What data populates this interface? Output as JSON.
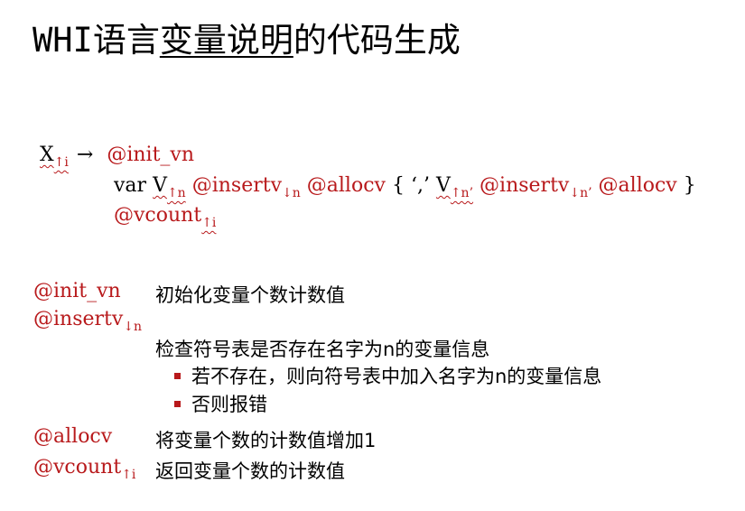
{
  "title": {
    "part1": "WHI语言",
    "part2": "变量说明",
    "part3": "的代码生成"
  },
  "rule": {
    "lhs": "X",
    "lhs_sub": "↑i",
    "arrow": "→",
    "action_init": "@init_vn",
    "kw_var": "var",
    "v": "V",
    "v_sub": "↑n",
    "action_insert": "@insertv",
    "insert_sub": "↓n",
    "action_alloc": "@allocv",
    "brace_open": "{",
    "comma": "‘,’",
    "v2": "V",
    "v2_sub": "↑n’",
    "action_insert2": "@insertv",
    "insert2_sub": "↓n’",
    "action_alloc2": "@allocv",
    "brace_close": "}",
    "action_vcount": "@vcount",
    "vcount_sub": "↑i"
  },
  "descriptions": [
    {
      "name": "@init_vn",
      "sub": "",
      "text": "初始化变量个数计数值"
    },
    {
      "name": "@insertv",
      "sub": "↓n",
      "text": "检查符号表是否存在名字为n的变量信息"
    },
    {
      "name": "@allocv",
      "sub": "",
      "text": "将变量个数的计数值增加1"
    },
    {
      "name": "@vcount",
      "sub": "↑i",
      "text": "返回变量个数的计数值"
    }
  ],
  "bullets": [
    "若不存在，则向符号表中加入名字为n的变量信息",
    "否则报错"
  ],
  "colors": {
    "accent_red": "#b8191b",
    "text": "#000000",
    "background": "#ffffff"
  }
}
